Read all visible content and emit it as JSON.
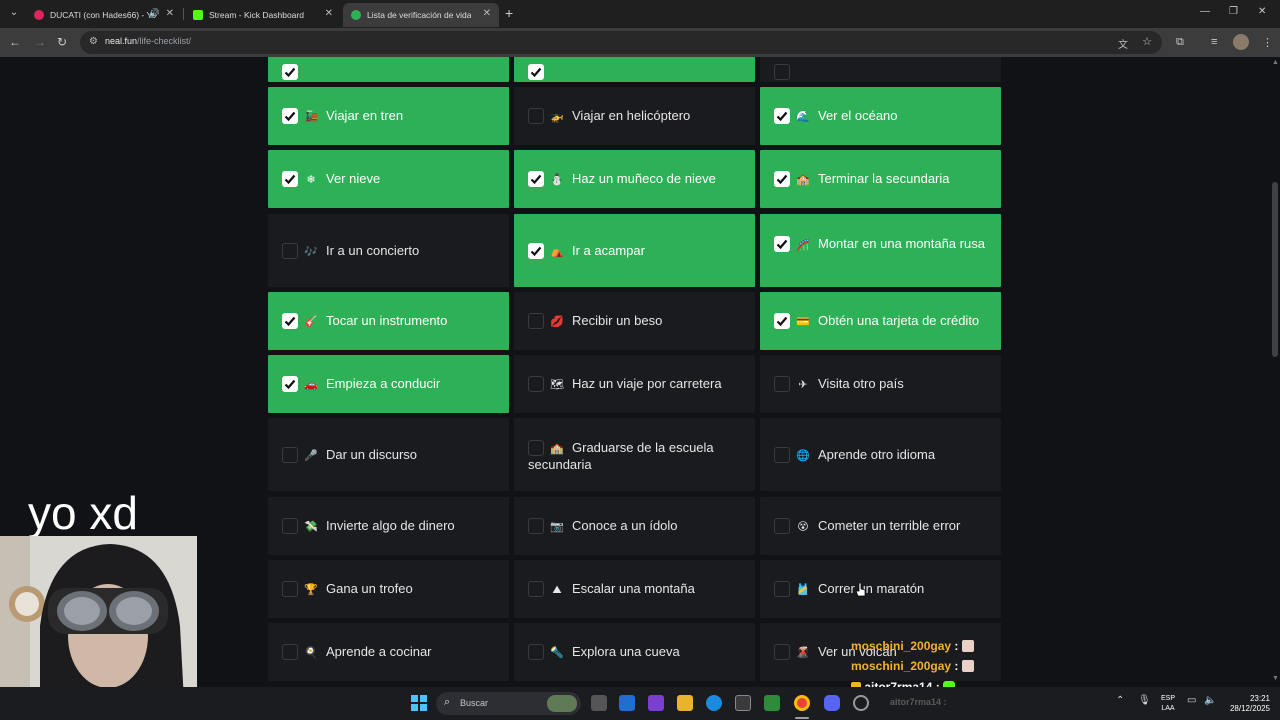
{
  "browser": {
    "tabs": [
      {
        "title": "DUCATI (con Hades66) - Yo",
        "favicon_color": "#e0245e",
        "active": false
      },
      {
        "title": "Stream - Kick Dashboard",
        "favicon_color": "#53fc18",
        "active": false
      },
      {
        "title": "Lista de verificación de vida",
        "favicon_color": "#2eb156",
        "active": true
      }
    ],
    "url_domain": "neal.fun",
    "url_path": "/life-checklist/"
  },
  "checklist": {
    "items": [
      {
        "label": "",
        "emoji": "",
        "checked": true
      },
      {
        "label": "",
        "emoji": "",
        "checked": true
      },
      {
        "label": "",
        "emoji": "",
        "checked": false
      },
      {
        "label": "Viajar en tren",
        "emoji": "🚂",
        "checked": true
      },
      {
        "label": "Viajar en helicóptero",
        "emoji": "🚁",
        "checked": false
      },
      {
        "label": "Ver el océano",
        "emoji": "🌊",
        "checked": true
      },
      {
        "label": "Ver nieve",
        "emoji": "❄",
        "checked": true
      },
      {
        "label": "Haz un muñeco de nieve",
        "emoji": "⛄",
        "checked": true
      },
      {
        "label": "Terminar la secundaria",
        "emoji": "🏫",
        "checked": true
      },
      {
        "label": "Ir a un concierto",
        "emoji": "🎶",
        "checked": false
      },
      {
        "label": "Ir a acampar",
        "emoji": "⛺",
        "checked": true
      },
      {
        "label": "Montar en una montaña rusa",
        "emoji": "🎢",
        "checked": true
      },
      {
        "label": "Tocar un instrumento",
        "emoji": "🎸",
        "checked": true
      },
      {
        "label": "Recibir un beso",
        "emoji": "💋",
        "checked": false
      },
      {
        "label": "Obtén una tarjeta de crédito",
        "emoji": "💳",
        "checked": true
      },
      {
        "label": "Empieza a conducir",
        "emoji": "🚗",
        "checked": true
      },
      {
        "label": "Haz un viaje por carretera",
        "emoji": "🗺",
        "checked": false
      },
      {
        "label": "Visita otro país",
        "emoji": "✈",
        "checked": false
      },
      {
        "label": "Dar un discurso",
        "emoji": "🎤",
        "checked": false
      },
      {
        "label": "Graduarse de la escuela secundaria",
        "emoji": "🏫",
        "checked": false
      },
      {
        "label": "Aprende otro idioma",
        "emoji": "🌐",
        "checked": false
      },
      {
        "label": "Invierte algo de dinero",
        "emoji": "💸",
        "checked": false
      },
      {
        "label": "Conoce a un ídolo",
        "emoji": "📷",
        "checked": false
      },
      {
        "label": "Cometer un terrible error",
        "emoji": "😵",
        "checked": false
      },
      {
        "label": "Gana un trofeo",
        "emoji": "🏆",
        "checked": false
      },
      {
        "label": "Escalar una montaña",
        "emoji": "⛰",
        "checked": false
      },
      {
        "label": "Correr un maratón",
        "emoji": "🎽",
        "checked": false
      },
      {
        "label": "Aprende a cocinar",
        "emoji": "🍳",
        "checked": false
      },
      {
        "label": "Explora una cueva",
        "emoji": "🔦",
        "checked": false
      },
      {
        "label": "Ver un volcán",
        "emoji": "🌋",
        "checked": false
      }
    ]
  },
  "overlay": {
    "cam_label": "yo xd",
    "chat": [
      {
        "user": "moschini_200gay",
        "sep": ":"
      },
      {
        "user": "moschini_200gay",
        "sep": ":"
      },
      {
        "user": "aitor7rma14",
        "sep": ":"
      }
    ]
  },
  "taskbar": {
    "search_placeholder": "Buscar",
    "lang_top": "ESP",
    "lang_bottom": "LAA",
    "time": "23:21",
    "date": "28/12/2025",
    "ghost_chat": "aitor7rma14 :"
  },
  "colors": {
    "checked": "#2eb156",
    "unchecked": "#1a1b1f",
    "page_bg": "#111216",
    "chat_user": "#f2b32a"
  }
}
